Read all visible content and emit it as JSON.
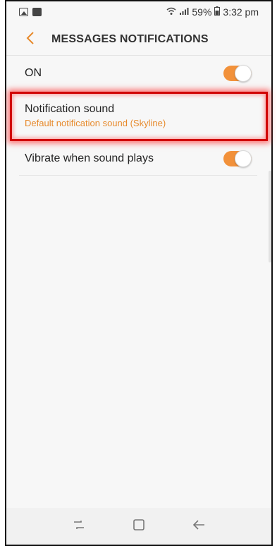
{
  "status_bar": {
    "battery": "59%",
    "time": "3:32 pm",
    "icons": [
      "image-icon",
      "message-icon",
      "wifi-icon",
      "signal-icon",
      "battery-icon"
    ]
  },
  "app_bar": {
    "title": "MESSAGES NOTIFICATIONS",
    "back_icon": "chevron-left-icon"
  },
  "settings": {
    "master": {
      "label": "ON",
      "enabled": true
    },
    "notification_sound": {
      "label": "Notification sound",
      "value": "Default notification sound (Skyline)"
    },
    "vibrate": {
      "label": "Vibrate when sound plays",
      "enabled": true
    }
  },
  "nav_bar": {
    "buttons": [
      "recents-icon",
      "home-icon",
      "back-icon"
    ]
  },
  "colors": {
    "accent": "#f2913a",
    "subtext": "#e78a2c",
    "highlight": "#d10000"
  }
}
